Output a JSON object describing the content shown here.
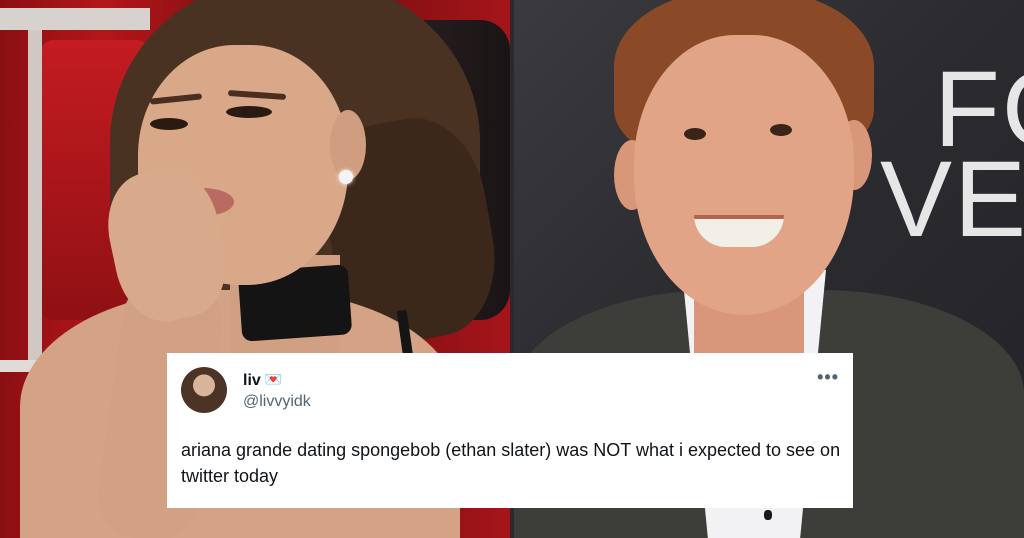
{
  "tweet": {
    "display_name": "liv",
    "name_emoji": "💌",
    "handle": "@livvyidk",
    "more_label": "•••",
    "text": "ariana grande dating spongebob (ethan slater) was NOT what i expected to see on twitter today"
  },
  "background": {
    "sign_line1": "FO",
    "sign_line2": "VER"
  },
  "colors": {
    "card_bg": "#ffffff",
    "text_primary": "#0f1419",
    "text_secondary": "#536471",
    "left_backdrop": "#b3161a",
    "right_backdrop": "#2b2b30"
  }
}
